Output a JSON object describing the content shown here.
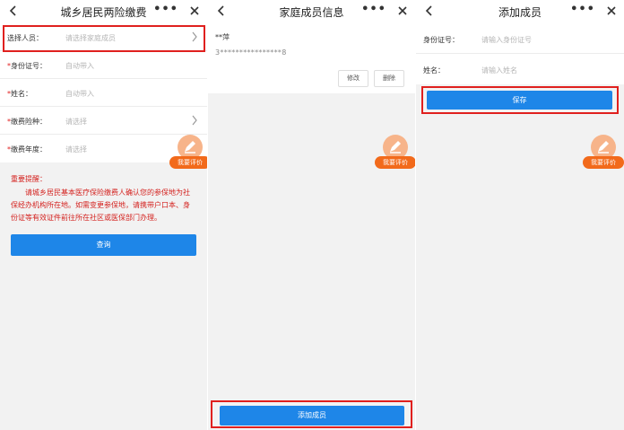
{
  "screen1": {
    "title": "城乡居民两险缴费",
    "more": "•••",
    "fields": [
      {
        "label": "选择人员：",
        "required": false,
        "placeholder": "请选择家庭成员",
        "chevron": true
      },
      {
        "label": "身份证号：",
        "required": true,
        "placeholder": "自动带入",
        "chevron": false
      },
      {
        "label": "姓名：",
        "required": true,
        "placeholder": "自动带入",
        "chevron": false
      },
      {
        "label": "缴费险种：",
        "required": true,
        "placeholder": "请选择",
        "chevron": true
      },
      {
        "label": "缴费年度：",
        "required": true,
        "placeholder": "请选择",
        "chevron": false
      }
    ],
    "required_mark": "*",
    "notice_title": "重要提醒：",
    "notice_body": "请城乡居民基本医疗保险缴费人确认您的参保地为社保经办机构所在地。如需变更参保地，请携带户口本、身份证等有效证件前往所在社区或医保部门办理。",
    "query_button": "查询",
    "rate_label": "我要评价"
  },
  "screen2": {
    "title": "家庭成员信息",
    "more": "•••",
    "member_name": "**萍",
    "member_id": "3****************8",
    "edit_button": "修改",
    "delete_button": "删除",
    "add_button": "添加成员",
    "rate_label": "我要评价"
  },
  "screen3": {
    "title": "添加成员",
    "more": "•••",
    "id_label": "身份证号：",
    "id_placeholder": "请输入身份证号",
    "name_label": "姓名：",
    "name_placeholder": "请输入姓名",
    "save_button": "保存",
    "rate_label": "我要评价"
  },
  "colors": {
    "accent": "#1e86e8",
    "highlight": "#e0201e",
    "notice": "#d4221f",
    "rate_badge": "#f26a1b"
  }
}
